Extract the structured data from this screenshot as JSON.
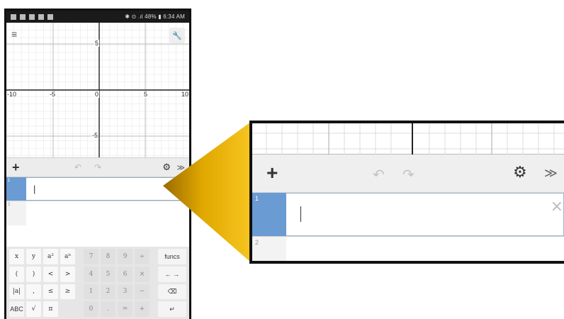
{
  "statusbar": {
    "right": "✱ ⊙ .ıl 48% ▮ 6:34 AM"
  },
  "graph": {
    "x_ticks": [
      "-10",
      "-5",
      "0",
      "5",
      "10"
    ],
    "y_ticks": [
      "5",
      "-5"
    ]
  },
  "toolbar": {
    "add": "+",
    "undo": "↶",
    "redo": "↷",
    "settings": "⚙",
    "collapse": "≫"
  },
  "expressions": [
    {
      "index": "1",
      "value": "|"
    },
    {
      "index": "2",
      "value": ""
    }
  ],
  "keypad": {
    "row1": [
      "x",
      "y",
      "a²",
      "aᵇ",
      "7",
      "8",
      "9",
      "÷",
      "funcs"
    ],
    "row2": [
      "(",
      ")",
      "<",
      ">",
      "4",
      "5",
      "6",
      "×",
      "← →"
    ],
    "row3": [
      "|a|",
      ",",
      "≤",
      "≥",
      "1",
      "2",
      "3",
      "−",
      "⌫"
    ],
    "row4": [
      "ABC",
      "√",
      "π",
      "",
      "0",
      ".",
      "=",
      "+",
      "↵"
    ]
  },
  "zoom": {
    "close": "×",
    "expr1_index": "1",
    "expr2_index": "2"
  },
  "colors": {
    "accent": "#6a9bd2",
    "callout": "#f2b705"
  }
}
